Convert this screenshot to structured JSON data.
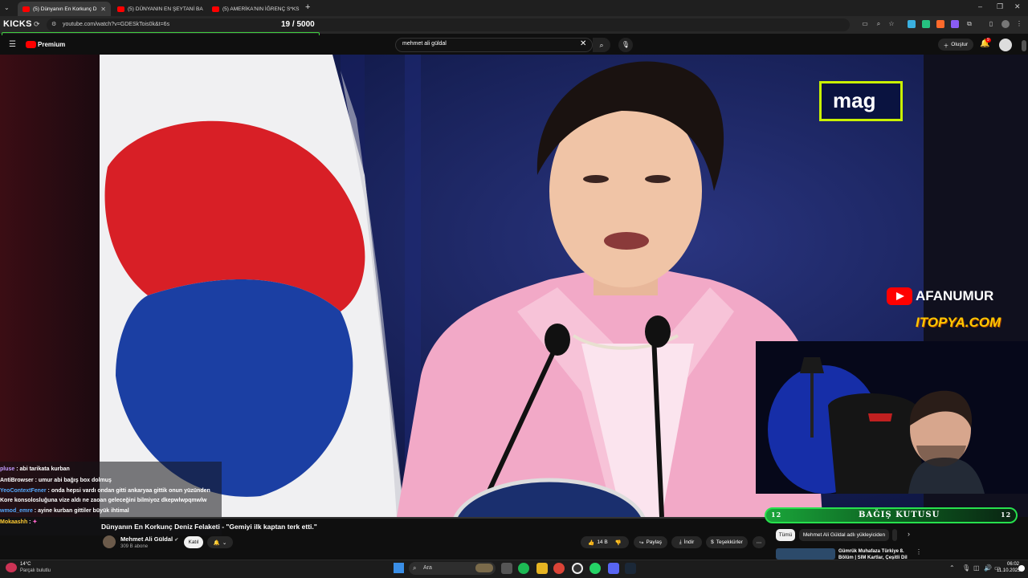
{
  "browser": {
    "tabs": [
      {
        "label": "(5) Dünyanın En Korkunç D",
        "active": true
      },
      {
        "label": "(5) DÜNYANIN EN ŞEYTANİ BA",
        "active": false
      },
      {
        "label": "(5) AMERİKA'NIN İĞRENÇ S*KS",
        "active": false
      }
    ],
    "new_tab": "+",
    "url": "youtube.com/watch?v=GDESkTois0k&t=6s"
  },
  "overlay": {
    "brand": "KICKS",
    "counter": "19  / 5000"
  },
  "youtube": {
    "logo_label": "Premium",
    "search_value": "mehmet ali güldal",
    "create_label": "Oluştur",
    "notif_count": "9"
  },
  "video": {
    "watermark": "mag",
    "sponsor1": "AFANUMUR",
    "sponsor2": "ITOPYA.COM"
  },
  "chat": [
    {
      "user": "pluse",
      "msg": "abi tarikata kurban",
      "color": "#c39bff"
    },
    {
      "user": "AntiBrowser",
      "msg": "umur abi bağış box dolmuş",
      "color": "#ffffff"
    },
    {
      "user": "YeoContextFener",
      "msg": "onda hepsi vardı ondan gitti ankaryaa gittik onun yüzünden Kore konsolosluğuna vize aldı ne zaoan geleceğini bilmiyoz dkepwlwpqmwlw",
      "color": "#55aaff"
    },
    {
      "user": "wmod_emre",
      "msg": "ayine kurban gittiler büyük ihtimal",
      "color": "#55aaff"
    },
    {
      "user": "Mokaashh",
      "msg": "",
      "color": "#ffcc33"
    }
  ],
  "below": {
    "title": "Dünyanın En Korkunç Deniz Felaketi - \"Gemiyi ilk kaptan terk etti.\"",
    "channel": "Mehmet Ali Güldal",
    "subscribers": "309 B abone",
    "join_label": "Katıl",
    "likes": "14 B",
    "share_label": "Paylaş",
    "download_label": "İndir",
    "thanks_label": "Teşekkürler"
  },
  "donation": {
    "label": "BAĞIŞ KUTUSU",
    "left_num": "12",
    "right_num": "12"
  },
  "sidebar": {
    "chips": [
      "Tümü",
      "Mehmet Ali Güldal adlı yükleyiciden"
    ],
    "rec_title": "Gümrük Muhafaza Türkiye 8. Bölüm | SIM Kartlar, Çeşitli Dil"
  },
  "taskbar": {
    "weather_temp": "14°C",
    "weather_desc": "Parçalı bulutlu",
    "search_placeholder": "Ara",
    "time": "06:02",
    "date": "11.10.2025"
  },
  "colors": {
    "accent_green": "#27e04d",
    "yt_red": "#ff0000",
    "mag_border": "#c9f000"
  }
}
